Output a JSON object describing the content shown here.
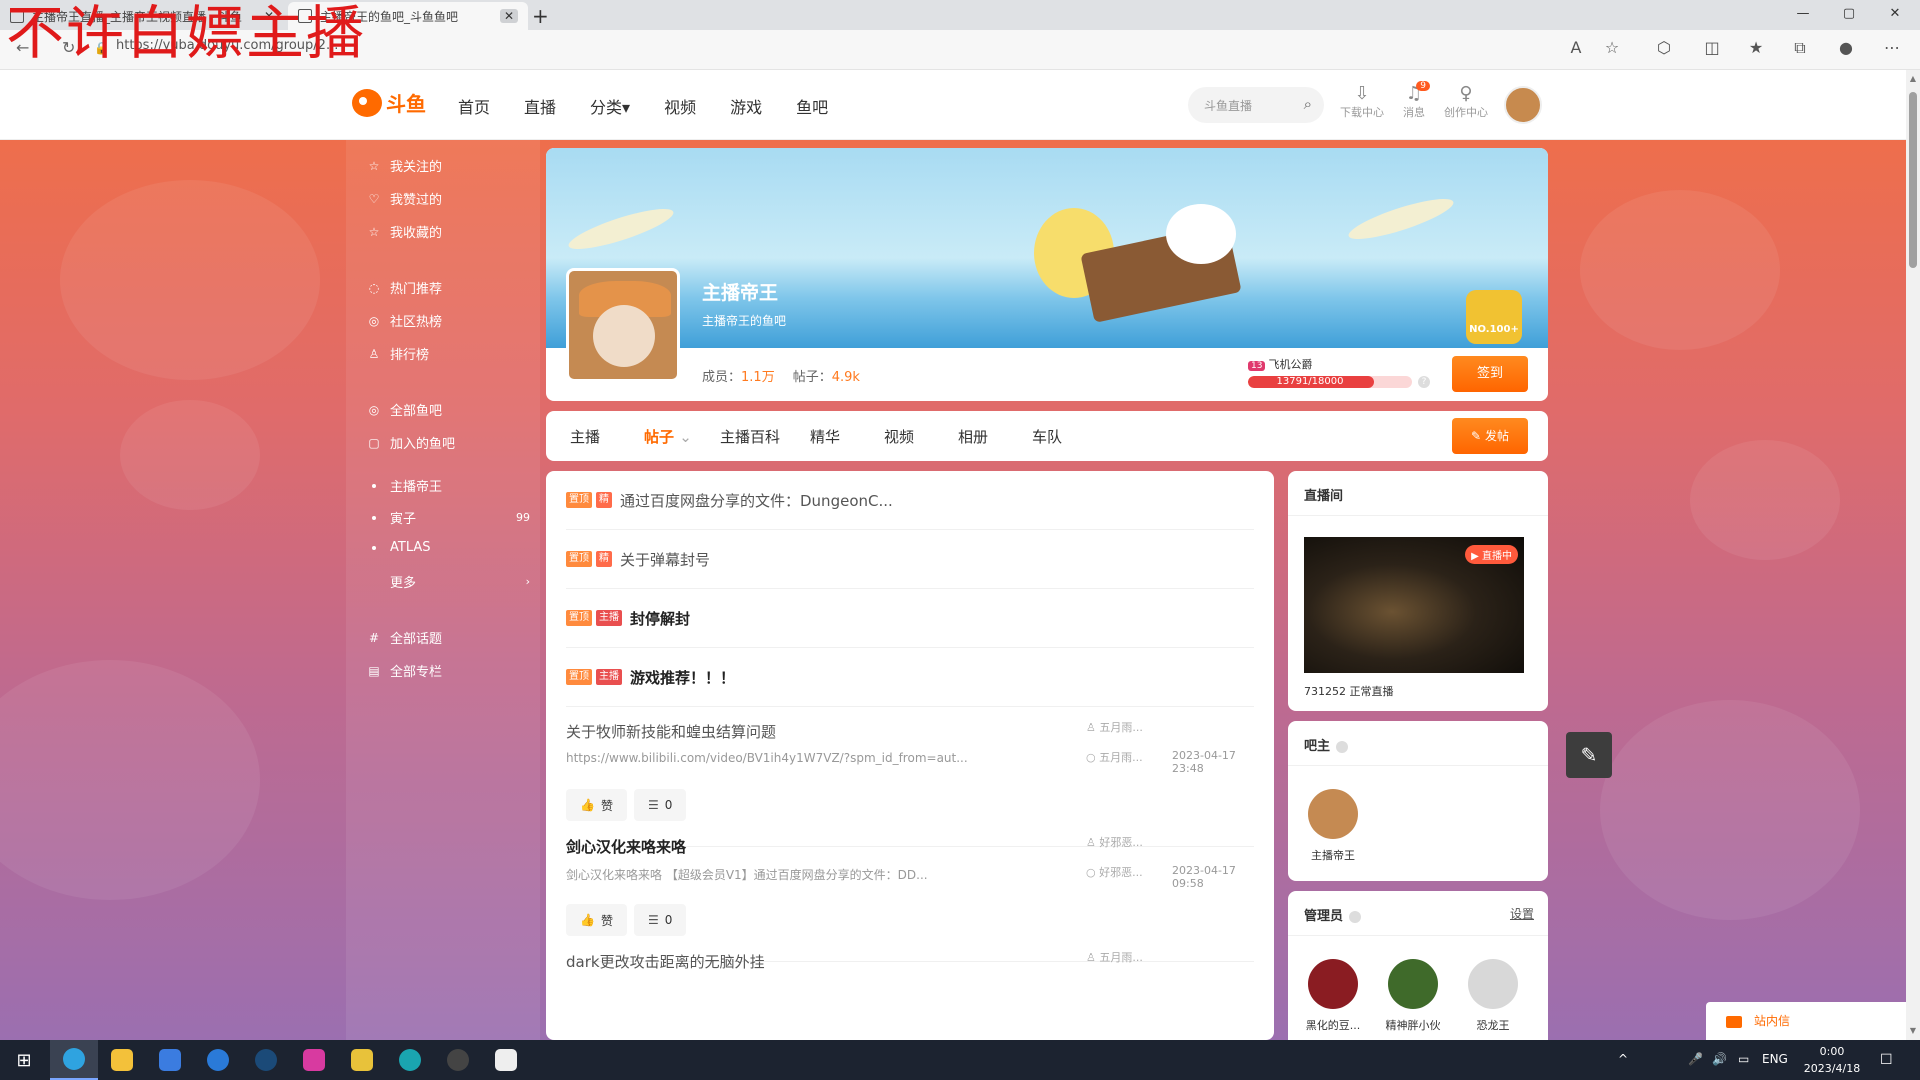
{
  "watermark": "不许白嫖主播",
  "browser": {
    "tabs": [
      {
        "title": "主播帝王直播_主播帝王视频直播 - 斗鱼"
      },
      {
        "title": "主播帝王的鱼吧_斗鱼鱼吧"
      }
    ],
    "new_tab": "+",
    "close": "✕",
    "url": "https://yuba.douyu.com/group/2...",
    "window_controls": [
      "—",
      "▢",
      "✕"
    ]
  },
  "site": {
    "logo_text": "斗鱼",
    "nav": [
      "首页",
      "直播",
      "分类▾",
      "视频",
      "游戏",
      "鱼吧"
    ],
    "search_placeholder": "斗鱼直播",
    "header_icons": [
      {
        "label": "下载中心",
        "icon": "download-icon"
      },
      {
        "label": "消息",
        "icon": "bell-icon",
        "badge": "9"
      },
      {
        "label": "创作中心",
        "icon": "bulb-icon"
      }
    ]
  },
  "sidebar": {
    "group1": [
      "我关注的",
      "我赞过的",
      "我收藏的"
    ],
    "group2": [
      "热门推荐",
      "社区热榜",
      "排行榜"
    ],
    "group3": [
      "全部鱼吧",
      "加入的鱼吧"
    ],
    "joined": [
      {
        "label": "主播帝王",
        "count": ""
      },
      {
        "label": "寅子",
        "count": "99"
      },
      {
        "label": "ATLAS",
        "count": ""
      },
      {
        "label": "更多",
        "count": "›"
      }
    ],
    "group4": [
      "全部话题",
      "全部专栏"
    ]
  },
  "group": {
    "name": "主播帝王",
    "subtitle": "主播帝王的鱼吧",
    "members_label": "成员：",
    "members": "1.1万",
    "posts_label": "帖子：",
    "posts": "4.9k",
    "rank_badge": "NO.100+",
    "level_badge": "13",
    "level_name": "飞机公爵",
    "level_progress": "13791/18000",
    "level_fraction": 0.766,
    "signin": "签到"
  },
  "tabs": [
    "主播",
    "帖子",
    "主播百科",
    "精华",
    "视频",
    "相册",
    "车队"
  ],
  "active_tab_arrow": "⌄",
  "post_button": "发帖",
  "pinned": [
    {
      "tags": [
        "置顶",
        "精"
      ],
      "title": "通过百度网盘分享的文件：DungeonC...",
      "bold": false
    },
    {
      "tags": [
        "置顶",
        "精"
      ],
      "title": "关于弹幕封号",
      "bold": false
    },
    {
      "tags": [
        "置顶",
        "主播"
      ],
      "title": "封停解封",
      "bold": true
    },
    {
      "tags": [
        "置顶",
        "主播"
      ],
      "title": "游戏推荐！！！",
      "bold": true
    }
  ],
  "posts": [
    {
      "title": "关于牧师新技能和蝗虫结算问题",
      "bold": false,
      "desc": "https://www.bilibili.com/video/BV1ih4y1W7VZ/?spm_id_from=aut...",
      "author": "五月雨...",
      "replier": "五月雨...",
      "time": "2023-04-17 23:48",
      "like": "赞",
      "comments": "0"
    },
    {
      "title": "剑心汉化来咯来咯",
      "bold": true,
      "desc": "剑心汉化来咯来咯 【超级会员V1】通过百度网盘分享的文件：DD...",
      "author": "好邪恶...",
      "replier": "好邪恶...",
      "time": "2023-04-17 09:58",
      "like": "赞",
      "comments": "0"
    },
    {
      "title": "dark更改攻击距离的无脑外挂",
      "bold": false,
      "desc": "",
      "author": "五月雨...",
      "replier": "",
      "time": "",
      "like": "",
      "comments": ""
    }
  ],
  "right": {
    "live": {
      "title": "直播间",
      "badge": "直播中",
      "caption": "731252 正常直播"
    },
    "owner": {
      "title": "吧主",
      "name": "主播帝王"
    },
    "admins": {
      "title": "管理员",
      "settings": "设置",
      "names": [
        "黑化的豆...",
        "精神胖小伙",
        "恐龙王"
      ]
    }
  },
  "inbox": "站内信",
  "taskbar": {
    "tray": [
      "^",
      "ENG"
    ],
    "time": "0:00",
    "date": "2023/4/18"
  },
  "colors": {
    "accent": "#ff6a00",
    "page_gradient_top": "#ee6e4c",
    "page_gradient_bottom": "#9b6fb0"
  }
}
